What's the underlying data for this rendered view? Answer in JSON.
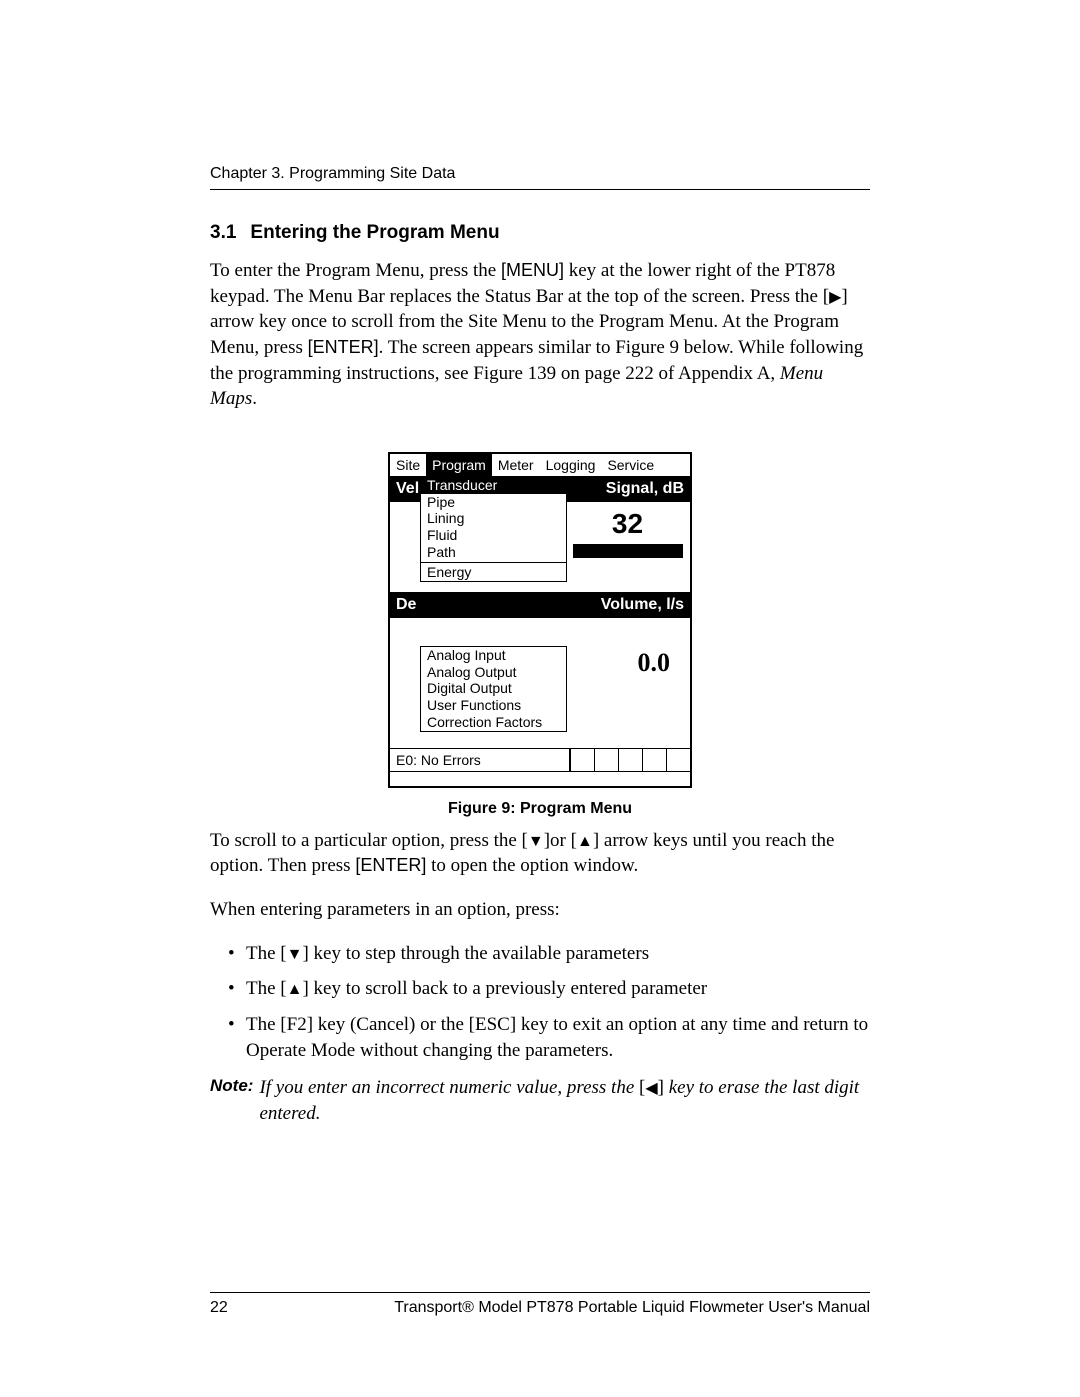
{
  "chapter_header": "Chapter 3. Programming Site Data",
  "section": {
    "number": "3.1",
    "title": "Entering the Program Menu"
  },
  "para1": {
    "t1": "To enter the Program Menu, press the ",
    "k1": "[MENU]",
    "t2": " key at the lower right of the PT878 keypad. The Menu Bar replaces the Status Bar at the top of the screen. Press the [",
    "t3": "] arrow key once to scroll from the Site Menu to the Program Menu. At the Program Menu, press ",
    "k2": "[ENTER]",
    "t4": ". The screen appears similar to Figure 9 below. While following the programming instructions, see Figure 139 on page 222 of Appendix A, ",
    "it": "Menu Maps",
    "t5": "."
  },
  "screen": {
    "tabs": [
      "Site",
      "Program",
      "Meter",
      "Logging",
      "Service"
    ],
    "active_tab_index": 1,
    "row1_left": "Vel",
    "row1_right": "Signal, dB",
    "row2_left": "De",
    "row2_right": "Volume, l/s",
    "value1": "32",
    "value2": "0.0",
    "dd1": [
      "Transducer",
      "Pipe",
      "Lining",
      "Fluid",
      "Path"
    ],
    "dd1_highlight_index": 0,
    "dd_energy": "Energy",
    "dd2": [
      "Analog Input",
      "Analog Output",
      "Digital Output",
      "User Functions",
      "Correction Factors"
    ],
    "error": "E0: No Errors"
  },
  "figure_caption": "Figure 9: Program Menu",
  "para2": {
    "t1": "To scroll to a particular option, press the [",
    "t2": "]or [",
    "t3": "] arrow keys until you reach the option. Then press ",
    "k1": "[ENTER]",
    "t4": " to open the option window."
  },
  "para3": "When entering parameters in an option, press:",
  "bullets": {
    "b1a": "The [",
    "b1b": "] key to step through the available parameters",
    "b2a": "The [",
    "b2b": "] key to scroll back to a previously entered parameter",
    "b3a": "The ",
    "b3k1": "[F2]",
    "b3b": " key (Cancel) or the ",
    "b3k2": "[ESC]",
    "b3c": " key to exit an option at any time and return to Operate Mode without changing the parameters."
  },
  "note": {
    "label": "Note:",
    "t1": "If you enter an incorrect numeric value, press the ",
    "t2": "[",
    "t3": "] ",
    "t4": "key to erase the last digit entered."
  },
  "footer": {
    "page": "22",
    "title": "Transport® Model PT878 Portable Liquid Flowmeter User's Manual"
  }
}
